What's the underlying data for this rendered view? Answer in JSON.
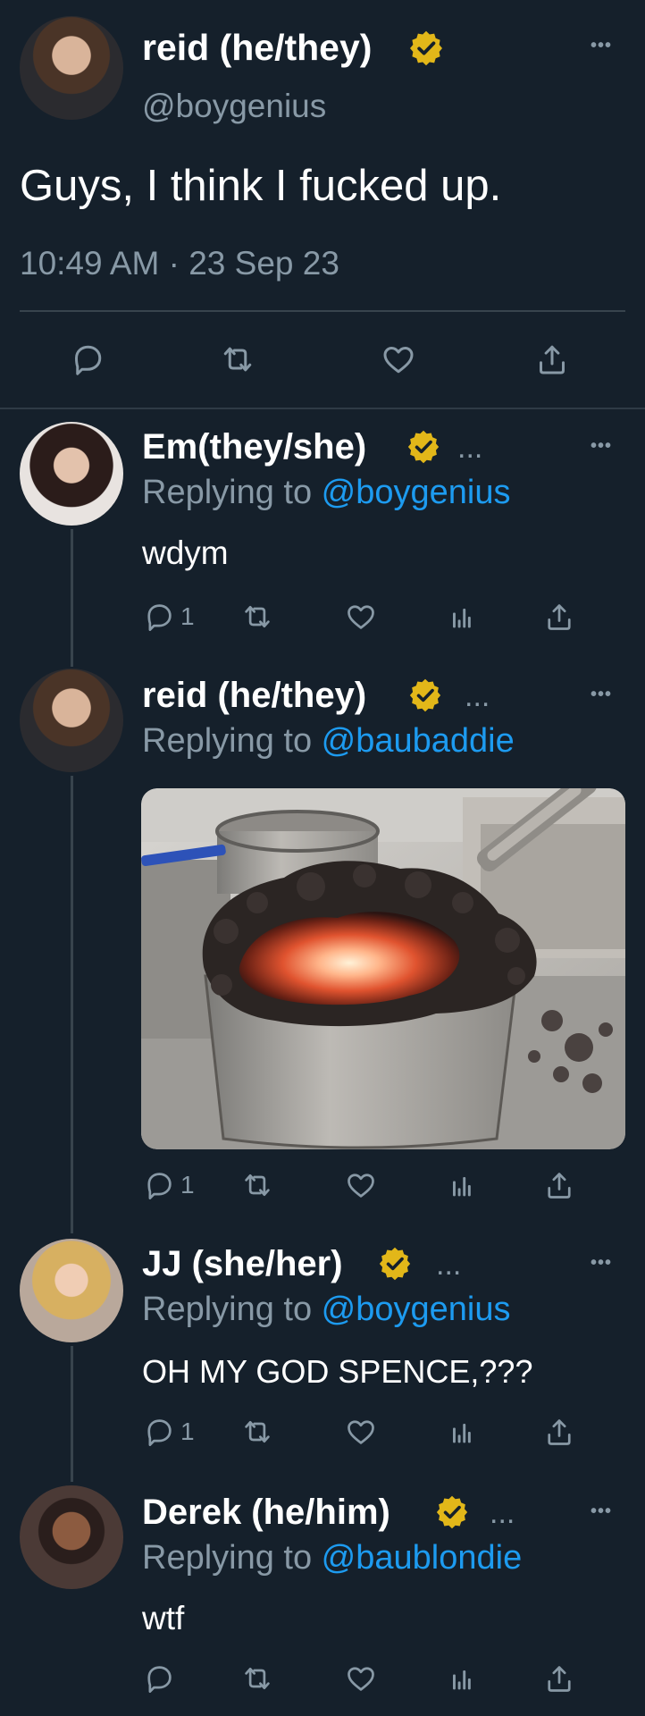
{
  "main_tweet": {
    "name": "reid (he/they)",
    "handle": "@boygenius",
    "text": "Guys, I think I fucked up.",
    "timestamp": "10:49 AM · 23 Sep 23"
  },
  "replies": [
    {
      "name": "Em(they/she)",
      "ellipsis": "...",
      "replying_prefix": "Replying to ",
      "replying_to": "@boygenius",
      "text": "wdym",
      "reply_count": "1"
    },
    {
      "name": "reid (he/they)",
      "ellipsis": "...",
      "replying_prefix": "Replying to ",
      "replying_to": "@baubaddie",
      "reply_count": "1"
    },
    {
      "name": "JJ (she/her)",
      "ellipsis": "...",
      "replying_prefix": "Replying to ",
      "replying_to": "@boygenius",
      "text": "OH MY GOD SPENCE,???",
      "reply_count": "1"
    },
    {
      "name": "Derek (he/him)",
      "ellipsis": "...",
      "replying_prefix": "Replying to ",
      "replying_to": "@baublondie",
      "text": "wtf"
    }
  ],
  "more_label": "•••",
  "colors": {
    "background": "#15202b",
    "text": "#e7e9ea",
    "secondary": "#8899a6",
    "link": "#1d9bf0",
    "verified_gold": "#e2b719"
  },
  "icons": [
    "reply-icon",
    "retweet-icon",
    "like-icon",
    "analytics-icon",
    "share-icon",
    "verified-badge-icon",
    "more-icon"
  ]
}
